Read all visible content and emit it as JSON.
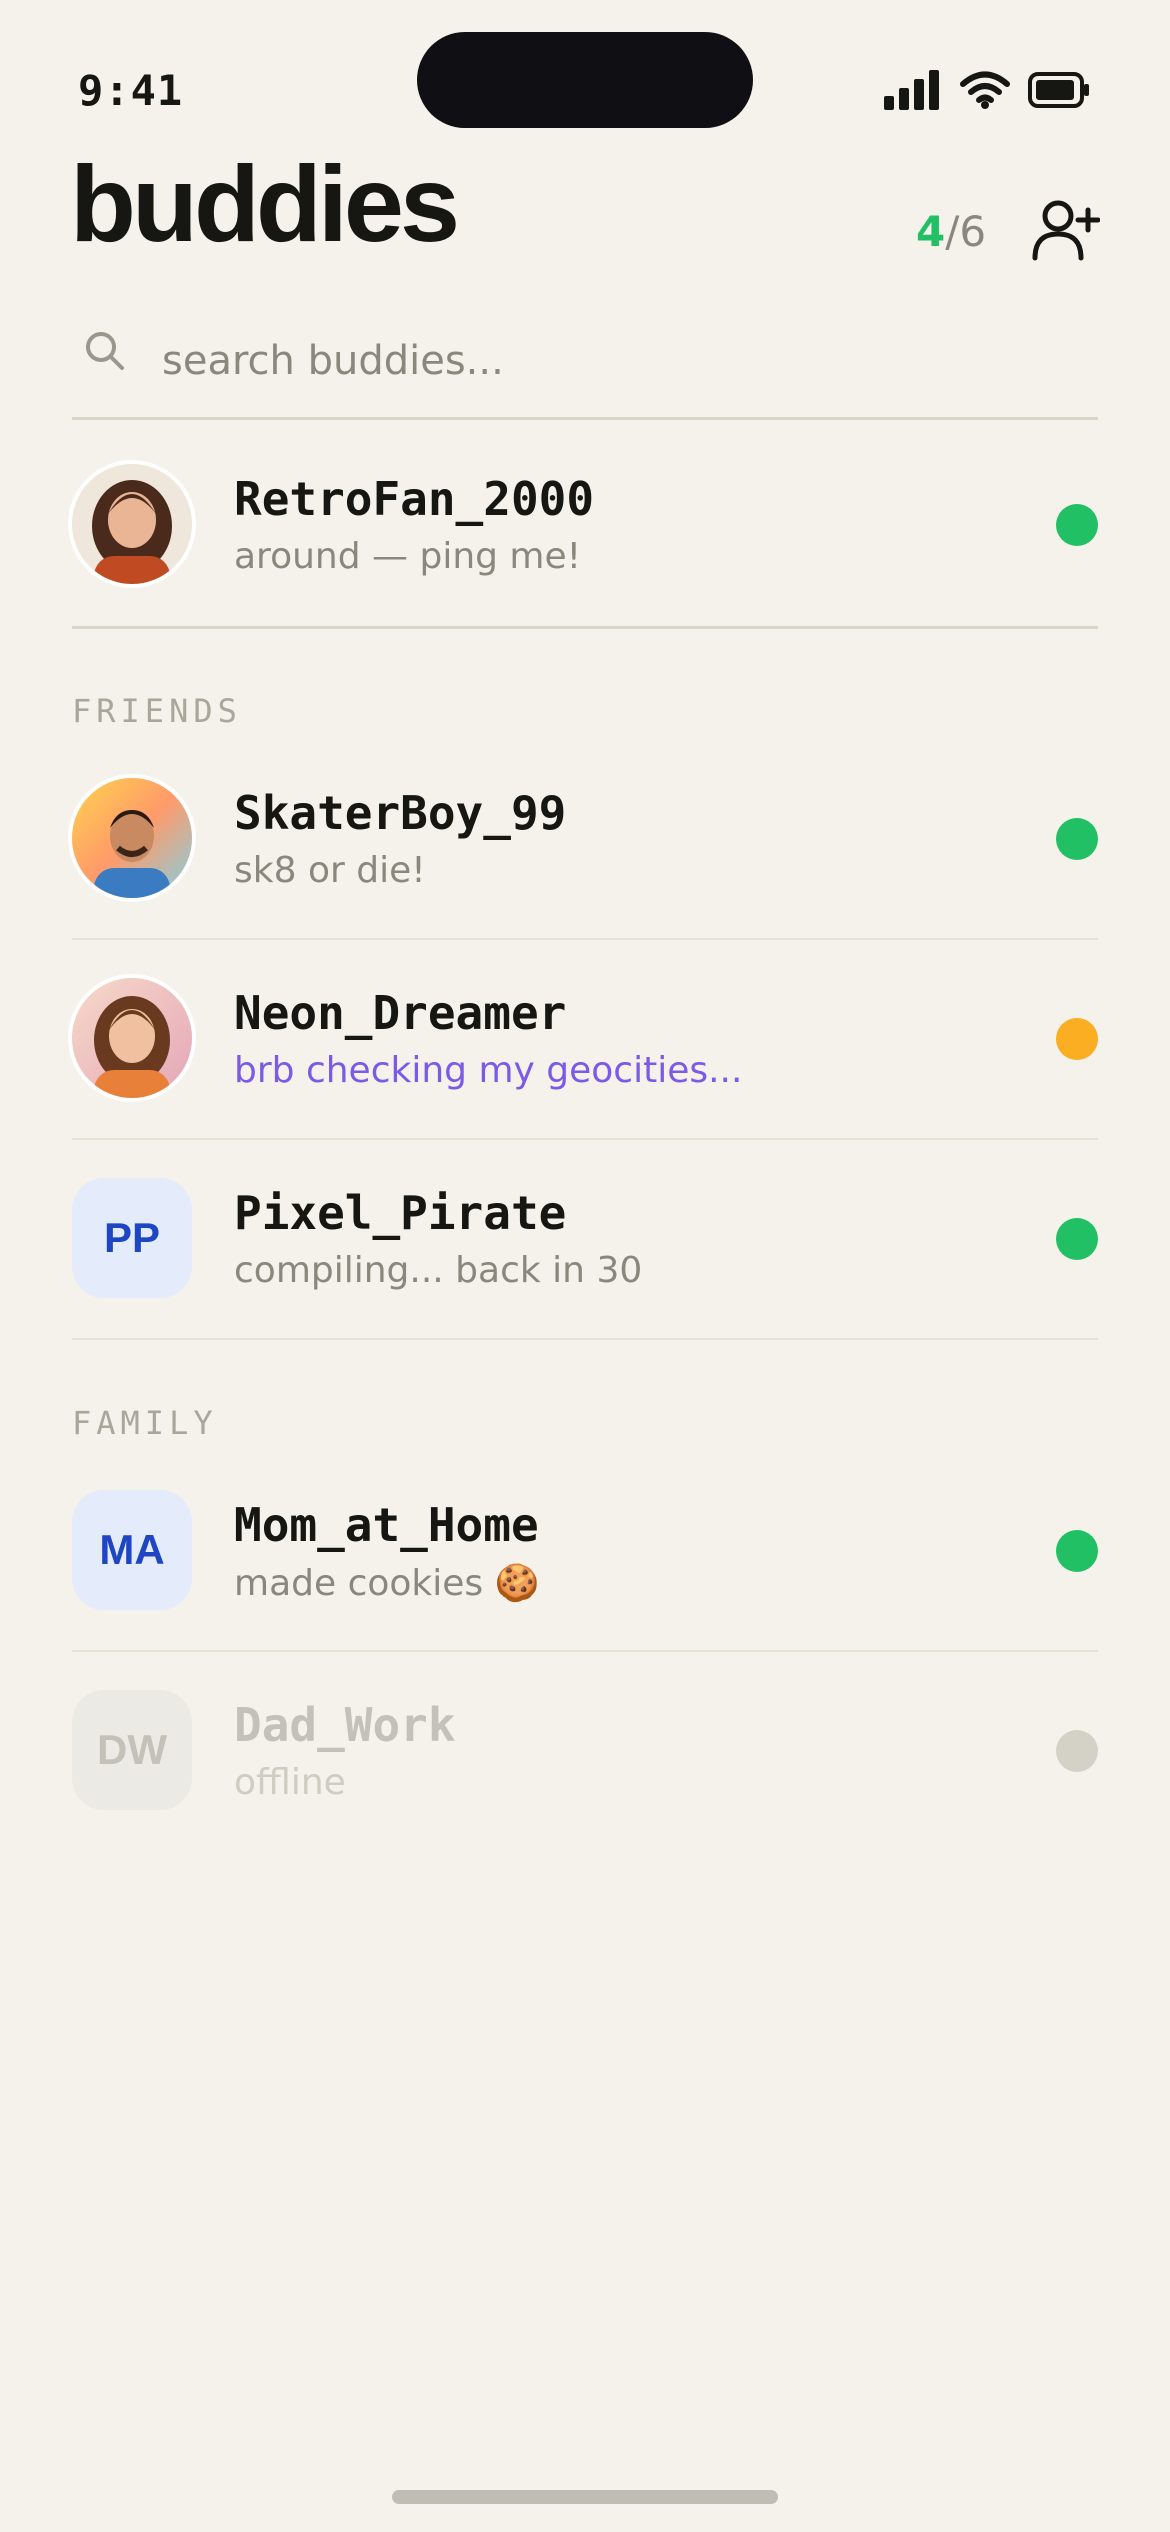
{
  "status": {
    "time": "9:41"
  },
  "header": {
    "title": "buddies",
    "online_count": "4",
    "total_count": "/6"
  },
  "search": {
    "placeholder": "search buddies..."
  },
  "pinned": {
    "name": "RetroFan_2000",
    "message": "around — ping me!",
    "status_color": "#22c064"
  },
  "sections": {
    "friends": "FRIENDS",
    "family": "FAMILY"
  },
  "friends": [
    {
      "name": "SkaterBoy_99",
      "message": "sk8 or die!",
      "status_color": "#22c064"
    },
    {
      "name": "Neon_Dreamer",
      "message": "brb checking my geocities...",
      "status_color": "#fbae22"
    },
    {
      "name": "Pixel_Pirate",
      "initials": "PP",
      "message": "compiling... back in 30",
      "status_color": "#22c064"
    }
  ],
  "family": [
    {
      "name": "Mom_at_Home",
      "initials": "MA",
      "message": "made cookies 🍪",
      "status_color": "#22c064"
    },
    {
      "name": "Dad_Work",
      "initials": "DW",
      "message": "offline",
      "status_color": "#d4d1c6"
    }
  ],
  "colors": {
    "online": "#22c064",
    "away": "#fbae22",
    "offline": "#d4d1c6",
    "accent_text": "#7a5ae6"
  }
}
